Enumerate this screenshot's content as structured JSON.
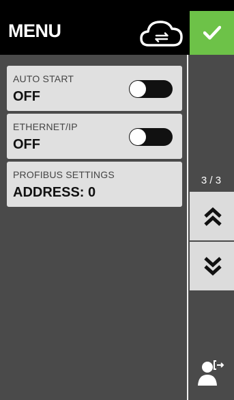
{
  "header": {
    "title": "MENU",
    "icons": {
      "cloud": "cloud-sync-icon",
      "confirm": "checkmark-icon"
    },
    "confirm_color": "#6dc248"
  },
  "settings": [
    {
      "label": "AUTO START",
      "value": "OFF",
      "toggle": false
    },
    {
      "label": "ETHERNET/IP",
      "value": "OFF",
      "toggle": false
    },
    {
      "label": "PROFIBUS SETTINGS",
      "value": "ADDRESS: 0"
    }
  ],
  "pagination": {
    "indicator": "3 / 3",
    "up_icon": "double-chevron-up-icon",
    "down_icon": "double-chevron-down-icon"
  },
  "footer": {
    "logout_icon": "user-logout-icon"
  }
}
